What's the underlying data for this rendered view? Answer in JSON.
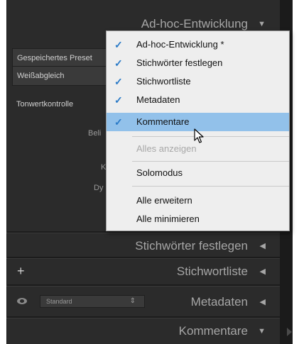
{
  "panel": {
    "headers": {
      "adhoc": "Ad-hoc-Entwicklung",
      "keywording": "Stichwörter festlegen",
      "keyword_list": "Stichwortliste",
      "metadata": "Metadaten",
      "comments": "Kommentare"
    },
    "rows": {
      "saved_preset": "Gespeichertes Preset",
      "white_balance": "Weißabgleich",
      "tone_control": "Tonwertkontrolle"
    },
    "slider_labels": {
      "exposure": "Beli",
      "k": "K",
      "dy": "Dy"
    },
    "metadata_preset": "Standard",
    "plus_symbol": "+"
  },
  "menu": {
    "items": [
      {
        "label": "Ad-hoc-Entwicklung *",
        "checked": true
      },
      {
        "label": "Stichwörter festlegen",
        "checked": true
      },
      {
        "label": "Stichwortliste",
        "checked": true
      },
      {
        "label": "Metadaten",
        "checked": true
      },
      {
        "label": "Kommentare",
        "checked": true,
        "highlighted": true
      },
      {
        "label": "Alles anzeigen",
        "disabled": true
      },
      {
        "label": "Solomodus"
      },
      {
        "label": "Alle erweitern"
      },
      {
        "label": "Alle minimieren"
      }
    ],
    "check_glyph": "✓"
  },
  "glyphs": {
    "collapsed": "◀",
    "expanded": "▼",
    "stepper": "⇕"
  },
  "colors": {
    "highlight": "#92c1ea",
    "check": "#2a7ac7",
    "panel_bg": "#2b2b2b"
  }
}
